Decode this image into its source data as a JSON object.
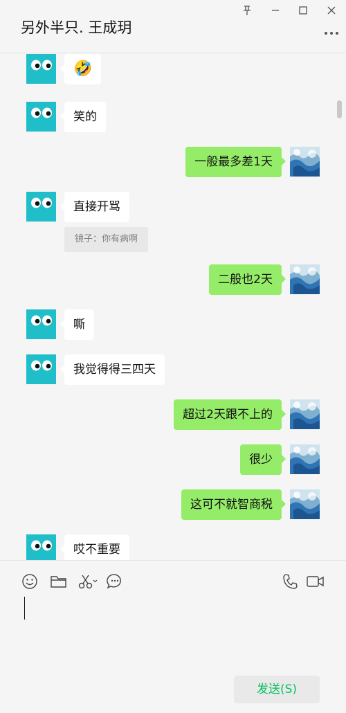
{
  "header": {
    "title": "另外半只. 王成玥"
  },
  "messages": [
    {
      "side": "left",
      "kind": "emoji",
      "text": "",
      "emoji": "🤣",
      "top": 0,
      "avatar_top": 0
    },
    {
      "side": "left",
      "kind": "text",
      "text": "笑的"
    },
    {
      "side": "right",
      "kind": "text",
      "text": "一般最多差1天"
    },
    {
      "side": "left",
      "kind": "text",
      "text": "直接开骂",
      "quote": "镜子：你有病啊"
    },
    {
      "side": "right",
      "kind": "text",
      "text": "二般也2天"
    },
    {
      "side": "left",
      "kind": "text",
      "text": "嘶"
    },
    {
      "side": "left",
      "kind": "text",
      "text": "我觉得得三四天"
    },
    {
      "side": "right",
      "kind": "text",
      "text": "超过2天跟不上的"
    },
    {
      "side": "right",
      "kind": "text",
      "text": "很少"
    },
    {
      "side": "right",
      "kind": "text",
      "text": "这可不就智商税"
    },
    {
      "side": "left",
      "kind": "text",
      "text": "哎不重要"
    }
  ],
  "toolbar": {
    "icons": [
      "emoji-icon",
      "folder-icon",
      "scissors-icon",
      "chat-history-icon"
    ],
    "right_icons": [
      "phone-icon",
      "video-call-icon"
    ]
  },
  "composer": {
    "value": ""
  },
  "send_button": {
    "label": "发送(S)"
  },
  "colors": {
    "own_bubble": "#95ec69",
    "other_bubble": "#ffffff",
    "send_text": "#07c160",
    "avatar_bg": "#1fbec9"
  }
}
